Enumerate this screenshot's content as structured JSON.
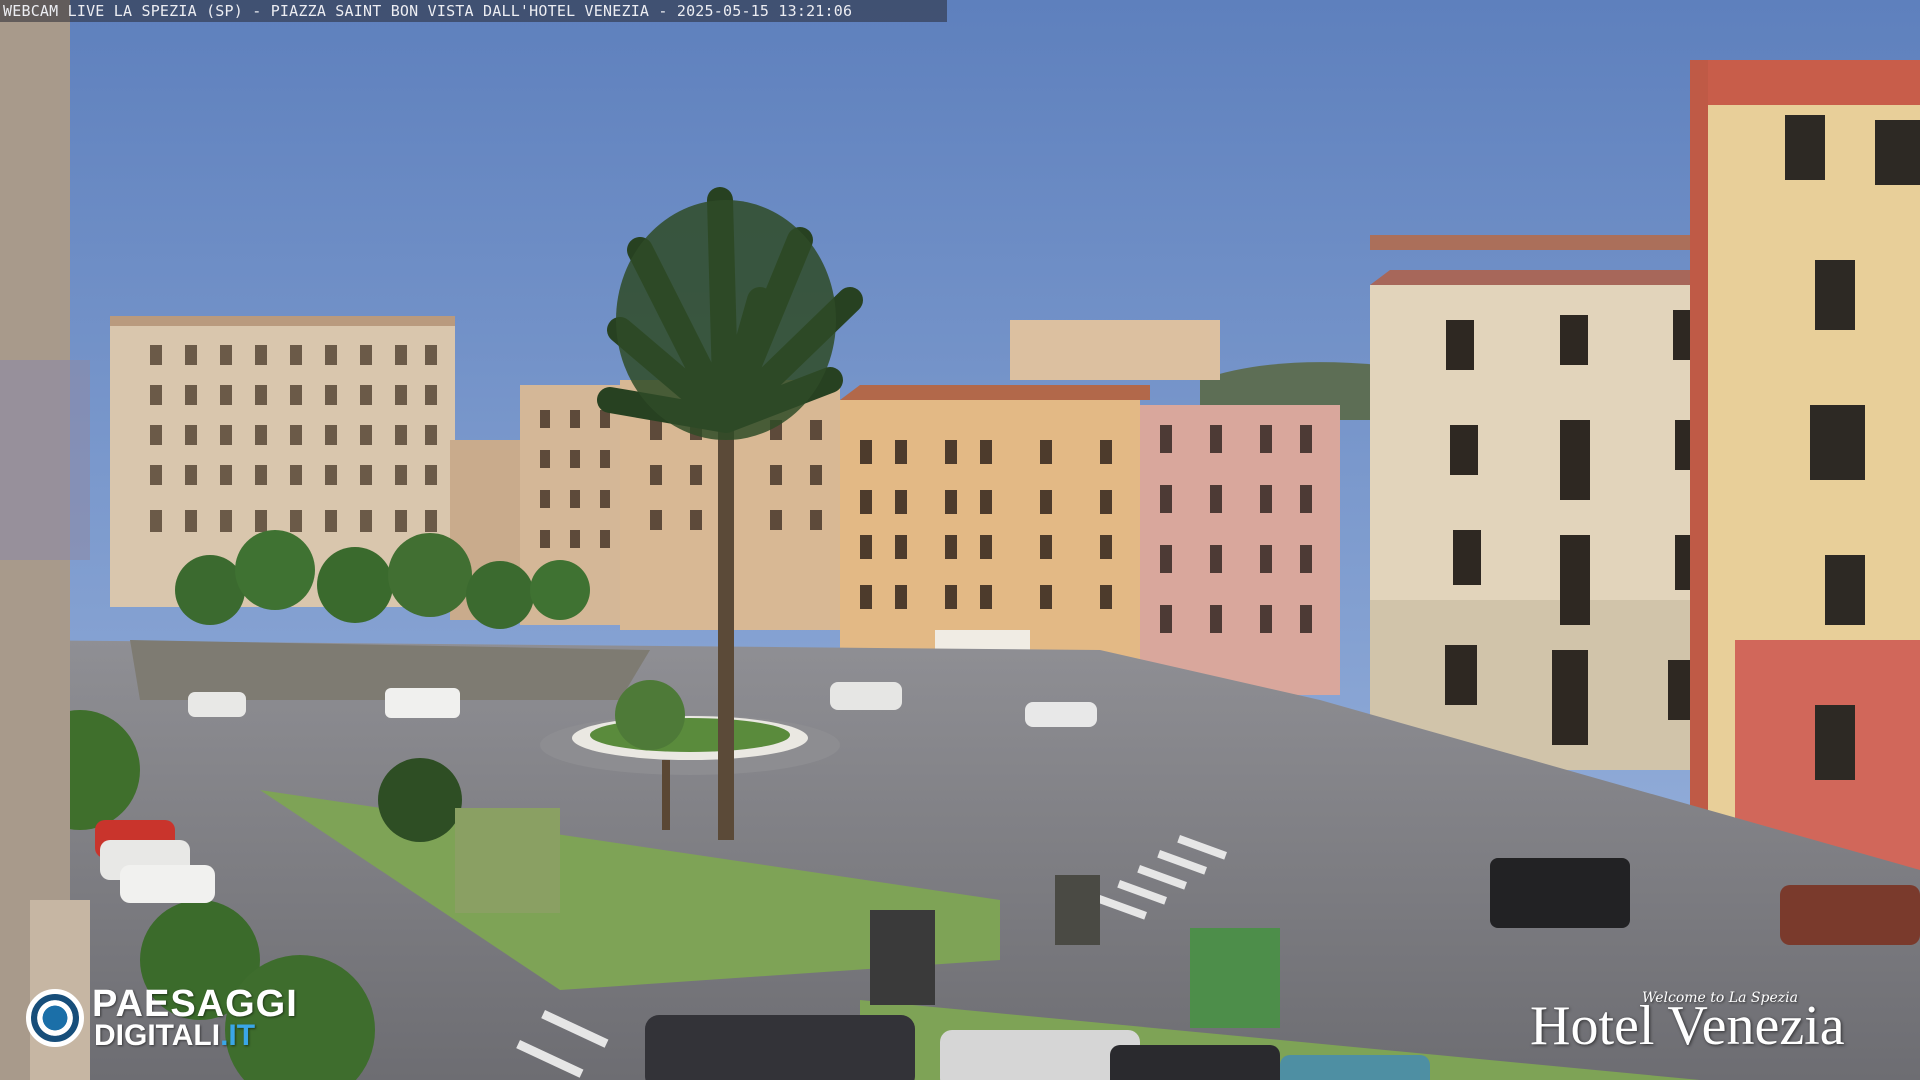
{
  "overlay": {
    "caption": "WEBCAM LIVE LA SPEZIA (SP) - PIAZZA SAINT BON VISTA DALL'HOTEL VENEZIA - 2025-05-15 13:21:06"
  },
  "logo_left": {
    "word1": "PAESAGGI",
    "word2a": "DIGITALI",
    "word2b": ".IT"
  },
  "logo_right": {
    "tagline": "Welcome to La Spezia",
    "name": "Hotel Venezia"
  },
  "colors": {
    "sky": "#6d8fc4",
    "brand_blue": "#3aa6e8"
  }
}
